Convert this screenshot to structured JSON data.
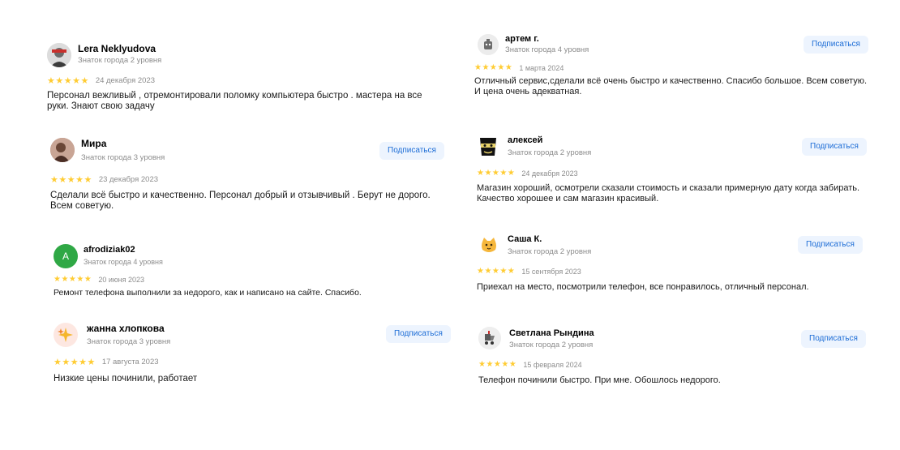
{
  "subscribe_label": "Подписаться",
  "colors": {
    "star": "#ffcc33",
    "accent": "#1d6dd6",
    "button_bg": "#edf4fe",
    "muted": "#8c8c8c"
  },
  "reviews": [
    {
      "name": "Lera Neklyudova",
      "level": "Знаток города 2 уровня",
      "rating": 5,
      "stars": "★★★★★",
      "date": "24 декабря 2023",
      "text": "Персонал вежливый , отремонтировали поломку компьютера быстро . мастера на все руки. Знают свою задачу",
      "avatar": "person-photo-icon",
      "has_subscribe": false
    },
    {
      "name": "Мира",
      "level": "Знаток города 3 уровня",
      "rating": 5,
      "stars": "★★★★★",
      "date": "23 декабря 2023",
      "text": "Сделали всё быстро и качественно. Персонал добрый и отзывчивый . Берут не дорого. Всем советую.",
      "avatar": "person-photo-icon",
      "has_subscribe": true
    },
    {
      "name": "afrodiziak02",
      "level": "Знаток города 4 уровня",
      "rating": 5,
      "stars": "★★★★★",
      "date": "20 июня 2023",
      "text": "Ремонт телефона выполнили за недорого, как и написано на сайте. Спасибо.",
      "avatar_letter": "A",
      "avatar_color": "#2fa845",
      "has_subscribe": false
    },
    {
      "name": "жанна хлопкова",
      "level": "Знаток города 3 уровня",
      "rating": 5,
      "stars": "★★★★★",
      "date": "17 августа 2023",
      "text": "Низкие цены починили, работает",
      "avatar": "sparkles-icon",
      "has_subscribe": true
    },
    {
      "name": "артем г.",
      "level": "Знаток города 4 уровня",
      "rating": 5,
      "stars": "★★★★★",
      "date": "1 марта 2024",
      "text": "Отличный сервис,сделали всё очень быстро и качественно. Спасибо большое. Всем советую. И цена очень адекватная.",
      "avatar": "robot-icon",
      "has_subscribe": true
    },
    {
      "name": "алексей",
      "level": "Знаток города 2 уровня",
      "rating": 5,
      "stars": "★★★★★",
      "date": "24 декабря 2023",
      "text": "Магазин хороший, осмотрели сказали стоимость и сказали примерную дату когда забирать. Качество хорошее и сам магазин красивый.",
      "avatar": "bandit-mask-icon",
      "has_subscribe": true
    },
    {
      "name": "Саша К.",
      "level": "Знаток города 2 уровня",
      "rating": 5,
      "stars": "★★★★★",
      "date": "15 сентября 2023",
      "text": "Приехал на место, посмотрили телефон, все понравилось, отличный персонал.",
      "avatar": "cat-icon",
      "has_subscribe": true
    },
    {
      "name": "Светлана Рындина",
      "level": "Знаток города 2 уровня",
      "rating": 5,
      "stars": "★★★★★",
      "date": "15 февраля 2024",
      "text": "Телефон починили быстро. При мне. Обошлось недорого.",
      "avatar": "baby-stroller-icon",
      "has_subscribe": true
    }
  ]
}
